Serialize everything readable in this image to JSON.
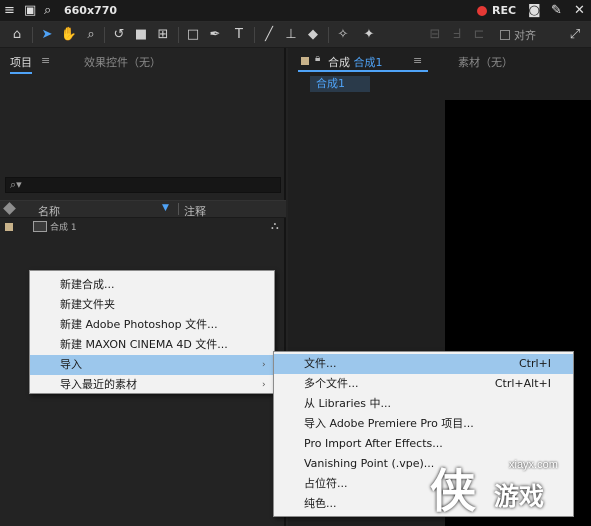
{
  "recorder": {
    "size_text": "660x770",
    "rec_label": "REC"
  },
  "toolbar": {
    "align_label": "对齐"
  },
  "project_panel": {
    "tab_project": "项目",
    "tab_effect_controls": "效果控件（无）",
    "col_name": "名称",
    "col_comment": "注释",
    "item_label": "合成 1"
  },
  "comp_panel": {
    "tab_prefix": "合成",
    "tab_name": "合成1",
    "tab_footage": "素材（无）",
    "subtab": "合成1"
  },
  "context_menu": {
    "items": [
      {
        "label": "新建合成..."
      },
      {
        "label": "新建文件夹"
      },
      {
        "label": "新建 Adobe Photoshop 文件..."
      },
      {
        "label": "新建 MAXON CINEMA 4D 文件..."
      },
      {
        "label": "导入",
        "submenu_arrow": "›"
      },
      {
        "label": "导入最近的素材",
        "submenu_arrow": "›"
      }
    ]
  },
  "import_submenu": {
    "items": [
      {
        "label": "文件...",
        "shortcut": "Ctrl+I"
      },
      {
        "label": "多个文件...",
        "shortcut": "Ctrl+Alt+I"
      },
      {
        "label": "从 Libraries 中..."
      },
      {
        "label": "导入 Adobe Premiere Pro 项目..."
      },
      {
        "label": "Pro Import After Effects..."
      },
      {
        "label": "Vanishing Point (.vpe)..."
      },
      {
        "label": "占位符..."
      },
      {
        "label": "纯色..."
      }
    ]
  },
  "watermark": {
    "url": "xiayx.com",
    "glyph": "侠",
    "text": "游戏"
  },
  "colors": {
    "accent": "#4fa3f7",
    "rec": "#e53935",
    "menu_highlight": "#9cc7ec",
    "label_tag": "#c8b28a"
  }
}
